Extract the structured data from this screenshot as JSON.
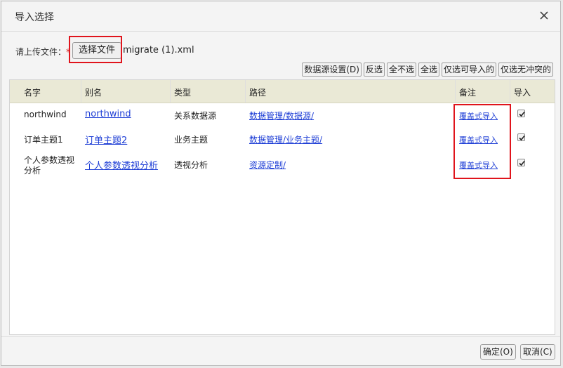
{
  "dialog": {
    "title": "导入选择"
  },
  "upload": {
    "label": "请上传文件：",
    "required_mark": "*",
    "choose_button": "选择文件",
    "file_name": "migrate (1).xml"
  },
  "toolbar": {
    "datasource_settings": "数据源设置(D)",
    "invert": "反选",
    "select_none": "全不选",
    "select_all": "全选",
    "select_importable": "仅选可导入的",
    "select_no_conflict": "仅选无冲突的"
  },
  "table": {
    "headers": {
      "name": "名字",
      "alias": "别名",
      "type": "类型",
      "path": "路径",
      "remark": "备注",
      "import": "导入"
    },
    "rows": [
      {
        "name": "northwind",
        "alias": "northwind",
        "type": "关系数据源",
        "path_a": "数据管理",
        "path_b": "/数据源/",
        "remark": "覆盖式导入",
        "import": true
      },
      {
        "name": "订单主题1",
        "alias": "订单主题2",
        "type": "业务主题",
        "path_a": "数据管理",
        "path_b": "/业务主题/",
        "remark": "覆盖式导入",
        "import": true
      },
      {
        "name_line1": "个人参数透视",
        "name_line2": "分析",
        "alias": "个人参数透视分析",
        "type": "透视分析",
        "path_a": "资源定制/",
        "remark": "覆盖式导入",
        "import": true
      }
    ]
  },
  "footer": {
    "ok": "确定(O)",
    "cancel": "取消(C)"
  },
  "colors": {
    "header_bg": "#eae9d6",
    "link": "#1f3fd6",
    "highlight": "#e0141c",
    "required": "#d62a2a"
  }
}
